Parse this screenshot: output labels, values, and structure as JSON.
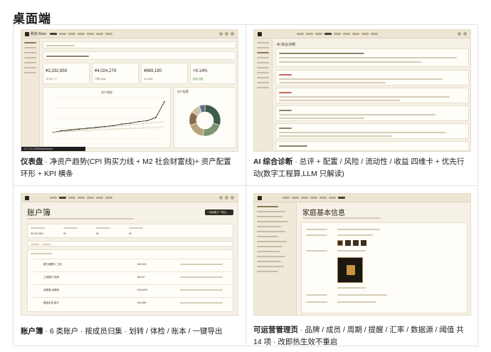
{
  "page_title": "桌面端",
  "panels": [
    {
      "caption_bold": "仪表盘",
      "caption_rest": " · 净资产趋势(CPI 购买力线 + M2 社会财富线)+ 资产配置环形 + KPI 横条",
      "brand": "账房 Beta",
      "kpis": [
        {
          "value": "¥3,332,859",
          "sub": "+¥796_77"
        },
        {
          "value": "¥4,024,279",
          "sub": "下载 ¥26k"
        },
        {
          "value": "¥889,180",
          "sub": "¥4 ¥480"
        },
        {
          "value": "+9.14%",
          "sub": "购买力图 -"
        }
      ],
      "chart_title": "净资产趋势",
      "donut_title": "资产配置",
      "status_text": "127.0.0.1:5200/dashboard"
    },
    {
      "caption_bold": "AI 综合诊断",
      "caption_rest": " · 总评 + 配置 / 风险 / 流动性 / 收益 四维卡 + 优先行动(数字工程算,LLM 只解读)",
      "page_heading": "AI 综合诊断"
    },
    {
      "caption_bold": "账户簿",
      "caption_rest": " · 6 类账户 · 按成员归集 · 划转 / 体检 / 账本 / 一键导出",
      "page_heading": "账户簿",
      "rows": [
        {
          "name": "银行储蓄卡 工商",
          "amount": "¥45,915"
        },
        {
          "name": "工资银行 招商",
          "amount": "¥6,197"
        },
        {
          "name": "余额宝 余额宝",
          "amount": "¥111,878"
        },
        {
          "name": "基金定投 南方",
          "amount": "¥11,839"
        }
      ],
      "kpi_values": [
        "¥3,332,859",
        "¥0",
        "¥0",
        "¥0"
      ],
      "add_button": "+ 添加账户 / 导出"
    },
    {
      "caption_bold": "可运营管理页",
      "caption_rest": " · 品牌 / 成员 / 周期 / 提醒 / 汇率 / 数据源 / 阈值 共 14 项 · 改即热生效不重启",
      "page_heading": "家庭基本信息"
    }
  ],
  "chart_data": [
    {
      "type": "line",
      "title": "资产趋势",
      "series": [
        {
          "name": "",
          "values": [
            8,
            10,
            11,
            12,
            13,
            14,
            15,
            16,
            18,
            19,
            21,
            22,
            26,
            45
          ]
        },
        {
          "name": "",
          "values": [
            8,
            9,
            9,
            10,
            10,
            11,
            11,
            12,
            12,
            13,
            13,
            14,
            14,
            15
          ]
        },
        {
          "name": "",
          "values": [
            8,
            9,
            10,
            11,
            12,
            13,
            14,
            15,
            16,
            17,
            18,
            19,
            20,
            21
          ]
        }
      ],
      "ylim": [
        0,
        50
      ]
    },
    {
      "type": "pie",
      "title": "资产配置",
      "values": [
        {
          "label": "",
          "value": 30,
          "color": "#3f5c4a"
        },
        {
          "label": "",
          "value": 22,
          "color": "#7c9472"
        },
        {
          "label": "",
          "value": 18,
          "color": "#b7a47c"
        },
        {
          "label": "",
          "value": 14,
          "color": "#8f6b4e"
        },
        {
          "label": "",
          "value": 10,
          "color": "#c9c0ad"
        },
        {
          "label": "",
          "value": 6,
          "color": "#5d6f85"
        }
      ]
    }
  ]
}
